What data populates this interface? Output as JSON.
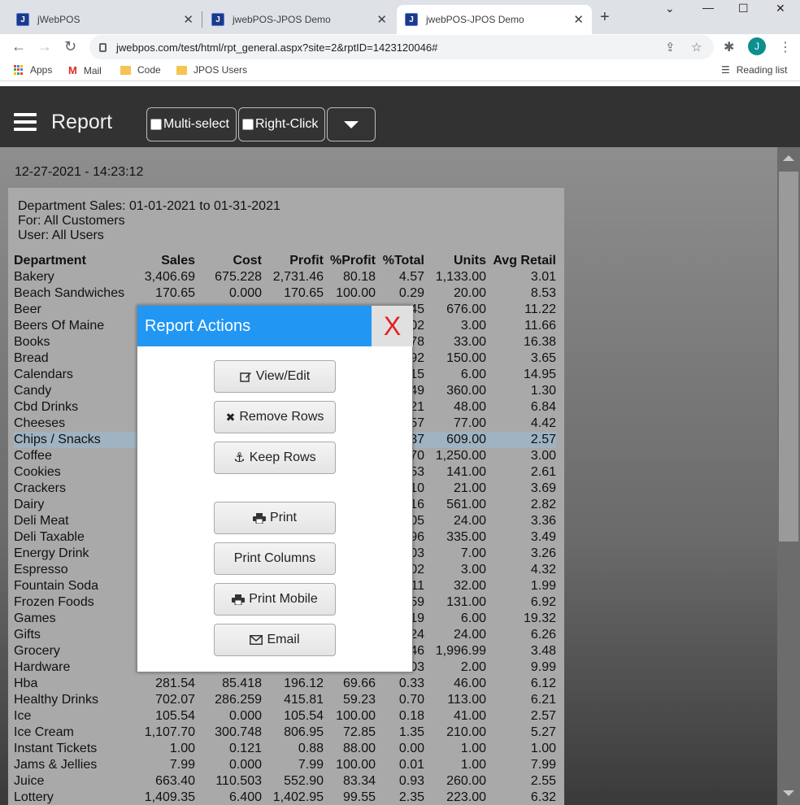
{
  "browser": {
    "tabs": [
      {
        "title": "jWebPOS",
        "active": false
      },
      {
        "title": "jwebPOS-JPOS Demo",
        "active": false
      },
      {
        "title": "jwebPOS-JPOS Demo",
        "active": true
      }
    ],
    "url": "jwebpos.com/test/html/rpt_general.aspx?site=2&rptID=1423120046#",
    "profile_initial": "J",
    "bookmarks": [
      "Apps",
      "Mail",
      "Code",
      "JPOS Users"
    ],
    "reading_list": "Reading list"
  },
  "app": {
    "title": "Report",
    "multi_select_label": "Multi-select",
    "right_click_label": "Right-Click",
    "timestamp": "12-27-2021 - 14:23:12",
    "report": {
      "header_line1": "Department Sales: 01-01-2021 to 01-31-2021",
      "header_line2": "For: All Customers",
      "header_line3": "User: All Users",
      "columns": [
        "Department",
        "Sales",
        "Cost",
        "Profit",
        "%Profit",
        "%Total",
        "Units",
        "Avg Retail"
      ],
      "rows": [
        [
          "Bakery",
          "3,406.69",
          "675.228",
          "2,731.46",
          "80.18",
          "4.57",
          "1,133.00",
          "3.01"
        ],
        [
          "Beach Sandwiches",
          "170.65",
          "0.000",
          "170.65",
          "100.00",
          "0.29",
          "20.00",
          "8.53"
        ],
        [
          "Beer",
          "",
          "",
          "",
          "",
          "45",
          "676.00",
          "11.22"
        ],
        [
          "Beers Of Maine",
          "",
          "",
          "",
          "",
          "02",
          "3.00",
          "11.66"
        ],
        [
          "Books",
          "",
          "",
          "",
          "",
          "78",
          "33.00",
          "16.38"
        ],
        [
          "Bread",
          "",
          "",
          "",
          "",
          "92",
          "150.00",
          "3.65"
        ],
        [
          "Calendars",
          "",
          "",
          "",
          "",
          "15",
          "6.00",
          "14.95"
        ],
        [
          "Candy",
          "",
          "",
          "",
          "",
          "49",
          "360.00",
          "1.30"
        ],
        [
          "Cbd Drinks",
          "",
          "",
          "",
          "",
          "21",
          "48.00",
          "6.84"
        ],
        [
          "Cheeses",
          "",
          "",
          "",
          "",
          "57",
          "77.00",
          "4.42"
        ],
        [
          "Chips / Snacks",
          "",
          "",
          "",
          "",
          "37",
          "609.00",
          "2.57"
        ],
        [
          "Coffee",
          "",
          "",
          "",
          "",
          "70",
          "1,250.00",
          "3.00"
        ],
        [
          "Cookies",
          "",
          "",
          "",
          "",
          "53",
          "141.00",
          "2.61"
        ],
        [
          "Crackers",
          "",
          "",
          "",
          "",
          "10",
          "21.00",
          "3.69"
        ],
        [
          "Dairy",
          "",
          "",
          "",
          "",
          "16",
          "561.00",
          "2.82"
        ],
        [
          "Deli Meat",
          "",
          "",
          "",
          "",
          "05",
          "24.00",
          "3.36"
        ],
        [
          "Deli Taxable",
          "",
          "",
          "",
          "",
          "96",
          "335.00",
          "3.49"
        ],
        [
          "Energy Drink",
          "",
          "",
          "",
          "",
          "03",
          "7.00",
          "3.26"
        ],
        [
          "Espresso",
          "",
          "",
          "",
          "",
          "02",
          "3.00",
          "4.32"
        ],
        [
          "Fountain Soda",
          "",
          "",
          "",
          "",
          "11",
          "32.00",
          "1.99"
        ],
        [
          "Frozen Foods",
          "",
          "",
          "",
          "",
          "59",
          "131.00",
          "6.92"
        ],
        [
          "Games",
          "",
          "",
          "",
          "",
          "19",
          "6.00",
          "19.32"
        ],
        [
          "Gifts",
          "",
          "",
          "",
          "",
          "24",
          "24.00",
          "6.26"
        ],
        [
          "Grocery",
          "",
          "",
          "",
          "",
          "46",
          "1,996.99",
          "3.48"
        ],
        [
          "Hardware",
          "",
          "",
          "",
          "",
          "03",
          "2.00",
          "9.99"
        ],
        [
          "Hba",
          "281.54",
          "85.418",
          "196.12",
          "69.66",
          "0.33",
          "46.00",
          "6.12"
        ],
        [
          "Healthy Drinks",
          "702.07",
          "286.259",
          "415.81",
          "59.23",
          "0.70",
          "113.00",
          "6.21"
        ],
        [
          "Ice",
          "105.54",
          "0.000",
          "105.54",
          "100.00",
          "0.18",
          "41.00",
          "2.57"
        ],
        [
          "Ice Cream",
          "1,107.70",
          "300.748",
          "806.95",
          "72.85",
          "1.35",
          "210.00",
          "5.27"
        ],
        [
          "Instant Tickets",
          "1.00",
          "0.121",
          "0.88",
          "88.00",
          "0.00",
          "1.00",
          "1.00"
        ],
        [
          "Jams & Jellies",
          "7.99",
          "0.000",
          "7.99",
          "100.00",
          "0.01",
          "1.00",
          "7.99"
        ],
        [
          "Juice",
          "663.40",
          "110.503",
          "552.90",
          "83.34",
          "0.93",
          "260.00",
          "2.55"
        ],
        [
          "Lottery",
          "1,409.35",
          "6.400",
          "1,402.95",
          "99.55",
          "2.35",
          "223.00",
          "6.32"
        ]
      ],
      "highlighted_row": "Chips / Snacks"
    }
  },
  "modal": {
    "title": "Report Actions",
    "close_label": "X",
    "buttons": {
      "view_edit": "View/Edit",
      "remove_rows": "Remove Rows",
      "keep_rows": "Keep Rows",
      "print": "Print",
      "print_columns": "Print Columns",
      "print_mobile": "Print Mobile",
      "email": "Email"
    }
  },
  "colors": {
    "modal_header": "#2196f3",
    "close_x": "#e02020",
    "row_highlight": "#9fb3c2"
  }
}
